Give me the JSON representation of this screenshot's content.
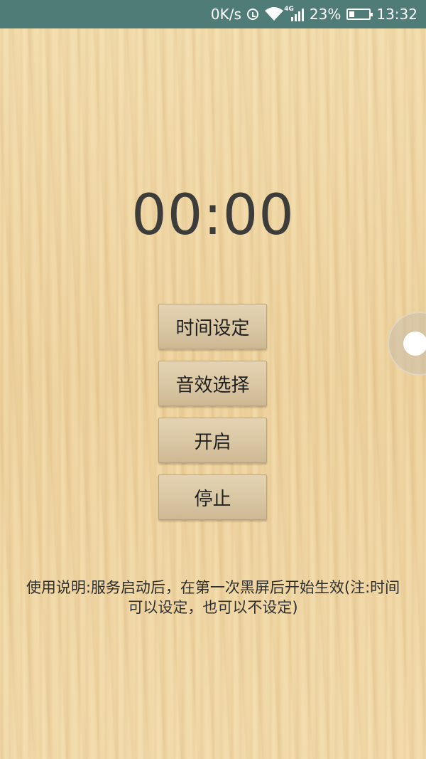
{
  "status_bar": {
    "net_speed": "0K/s",
    "network_type": "4G",
    "battery_percent": "23%",
    "time": "13:32",
    "icons": [
      "alarm-icon",
      "wifi-icon",
      "signal-icon",
      "battery-icon"
    ]
  },
  "timer": {
    "display": "00:00"
  },
  "buttons": {
    "time_setting": "时间设定",
    "sound_select": "音效选择",
    "start": "开启",
    "stop": "停止"
  },
  "instructions": {
    "line1": "使用说明:服务启动后，在第一次黑屏后开始生效(注:时间",
    "line2": "可以设定，也可以不设定)"
  },
  "colors": {
    "status_bar": "#4f7c77",
    "wood_background": "#f0d7a4",
    "button_face": "#d9c6a3",
    "timer_text": "#3c3c3a"
  }
}
